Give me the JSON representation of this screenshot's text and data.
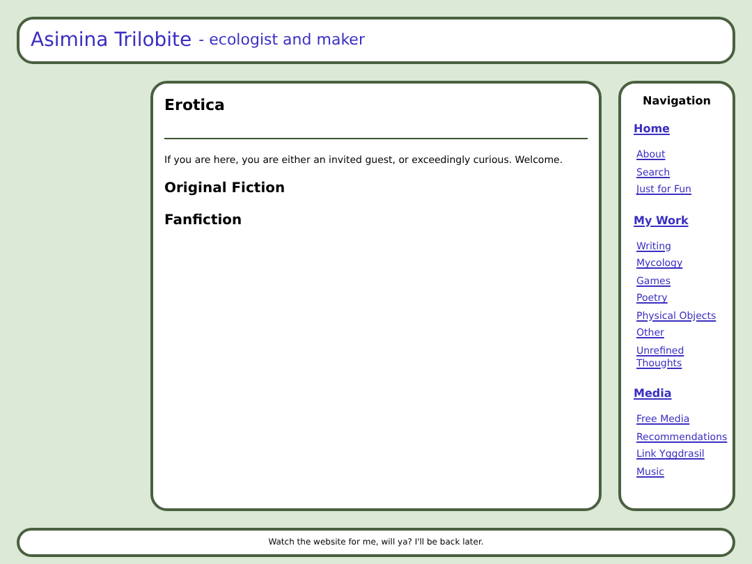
{
  "header": {
    "title": "Asimina Trilobite",
    "subtitle": "- ecologist and maker"
  },
  "main": {
    "heading": "Erotica",
    "intro": "If you are here, you are either an invited guest, or exceedingly curious. Welcome.",
    "sections": [
      "Original Fiction",
      "Fanfiction"
    ]
  },
  "navigation": {
    "title": "Navigation",
    "groups": [
      {
        "heading": "Home",
        "links": [
          "About",
          "Search",
          "Just for Fun"
        ]
      },
      {
        "heading": "My Work",
        "links": [
          "Writing",
          "Mycology",
          "Games",
          "Poetry",
          "Physical Objects",
          "Other",
          "Unrefined Thoughts"
        ]
      },
      {
        "heading": "Media",
        "links": [
          "Free Media",
          "Recommendations",
          "Link Yggdrasil",
          "Music"
        ]
      }
    ]
  },
  "footer": {
    "text": "Watch the website for me, will ya? I'll be back later."
  }
}
